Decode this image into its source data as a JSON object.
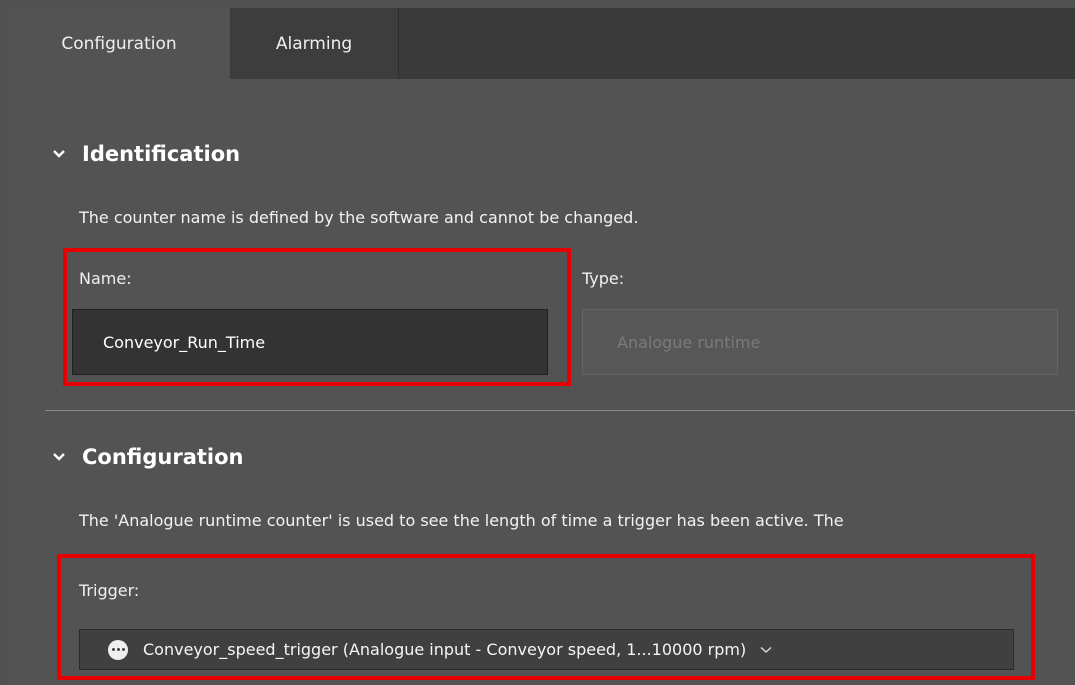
{
  "tabs": [
    {
      "label": "Configuration",
      "active": true
    },
    {
      "label": "Alarming",
      "active": false
    }
  ],
  "identification": {
    "heading": "Identification",
    "description": "The counter name is defined by the software and cannot be changed.",
    "name_label": "Name:",
    "name_value": "Conveyor_Run_Time",
    "type_label": "Type:",
    "type_value": "Analogue runtime"
  },
  "configuration": {
    "heading": "Configuration",
    "description": "The 'Analogue runtime counter' is used to see the length of time a trigger has been active. The",
    "trigger_label": "Trigger:",
    "trigger_value": "Conveyor_speed_trigger (Analogue input - Conveyor speed, 1...10000 rpm)"
  },
  "colors": {
    "highlight": "#e60000",
    "background": "#535353",
    "tabbar": "#3a3a3a"
  }
}
